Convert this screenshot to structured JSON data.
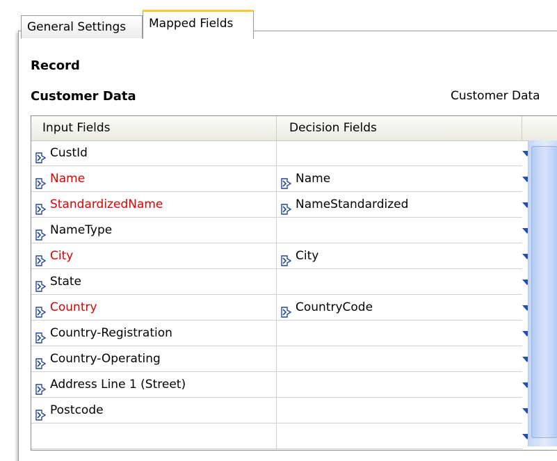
{
  "tabs": [
    {
      "label": "General Settings",
      "active": false
    },
    {
      "label": "Mapped Fields",
      "active": true
    }
  ],
  "record_heading": "Record",
  "section": {
    "title": "Customer Data",
    "right_label": "Customer Data"
  },
  "grid": {
    "columns": [
      "Input Fields",
      "Decision Fields"
    ],
    "rows": [
      {
        "input": "CustId",
        "mapped": false,
        "decision": ""
      },
      {
        "input": "Name",
        "mapped": true,
        "decision": "Name"
      },
      {
        "input": "StandardizedName",
        "mapped": true,
        "decision": "NameStandardized"
      },
      {
        "input": "NameType",
        "mapped": false,
        "decision": ""
      },
      {
        "input": "City",
        "mapped": true,
        "decision": "City"
      },
      {
        "input": "State",
        "mapped": false,
        "decision": ""
      },
      {
        "input": "Country",
        "mapped": true,
        "decision": "CountryCode"
      },
      {
        "input": "Country-Registration",
        "mapped": false,
        "decision": ""
      },
      {
        "input": "Country-Operating",
        "mapped": false,
        "decision": ""
      },
      {
        "input": "Address Line 1 (Street)",
        "mapped": false,
        "decision": ""
      },
      {
        "input": "Postcode",
        "mapped": false,
        "decision": ""
      },
      {
        "input": "",
        "mapped": false,
        "decision": ""
      }
    ]
  },
  "colors": {
    "mapped_text": "#e00000",
    "dropdown_arrow": "#2a4ea8",
    "active_tab_accent": "#ffc83c"
  },
  "icons": {
    "field": "field-icon",
    "dropdown": "dropdown-arrow-icon"
  }
}
